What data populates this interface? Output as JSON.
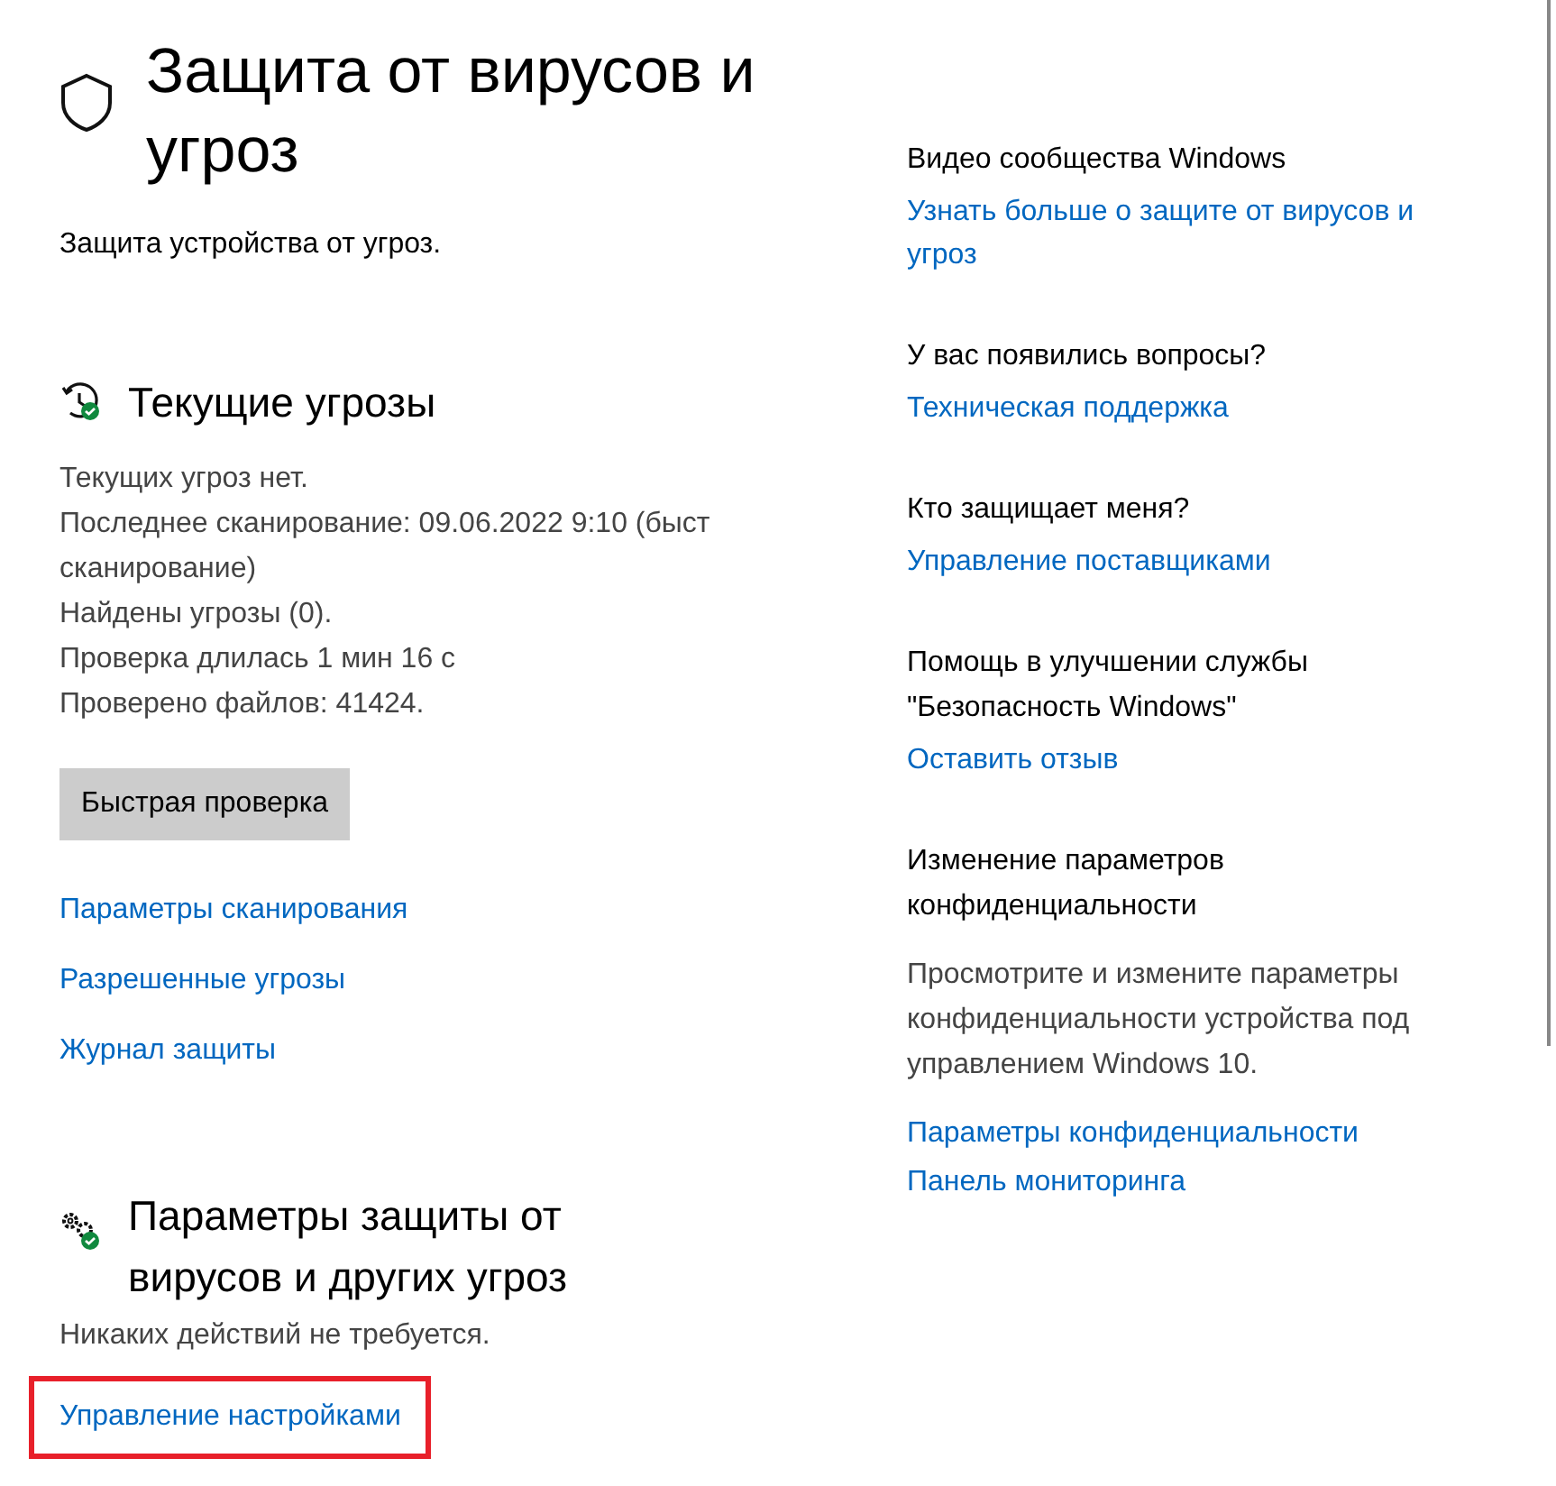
{
  "header": {
    "title": "Защита от вирусов и угроз",
    "subtitle": "Защита устройства от угроз."
  },
  "current_threats": {
    "heading": "Текущие угрозы",
    "lines": [
      "Текущих угроз нет.",
      "Последнее сканирование: 09.06.2022 9:10 (быст",
      "сканирование)",
      "Найдены угрозы (0).",
      "Проверка длилась 1 мин 16 с",
      "Проверено файлов: 41424."
    ],
    "button": "Быстрая проверка",
    "links": [
      "Параметры сканирования",
      "Разрешенные угрозы",
      "Журнал защиты"
    ]
  },
  "protection_settings": {
    "heading": "Параметры защиты от вирусов и других угроз",
    "status": "Никаких действий не требуется.",
    "link": {
      "label": "Управление настройками",
      "highlighted": true
    }
  },
  "sidebar": [
    {
      "heading": "Видео сообщества Windows",
      "links": [
        "Узнать больше о защите от вирусов и угроз"
      ]
    },
    {
      "heading": "У вас появились вопросы?",
      "links": [
        "Техническая поддержка"
      ]
    },
    {
      "heading": "Кто защищает меня?",
      "links": [
        "Управление поставщиками"
      ]
    },
    {
      "heading": "Помощь в улучшении службы \"Безопасность Windows\"",
      "links": [
        "Оставить отзыв"
      ]
    },
    {
      "heading": "Изменение параметров конфиденциальности",
      "text": "Просмотрите и измените параметры конфиденциальности устройства под управлением Windows 10.",
      "links": [
        "Параметры конфиденциальности",
        "Панель мониторинга"
      ]
    }
  ]
}
